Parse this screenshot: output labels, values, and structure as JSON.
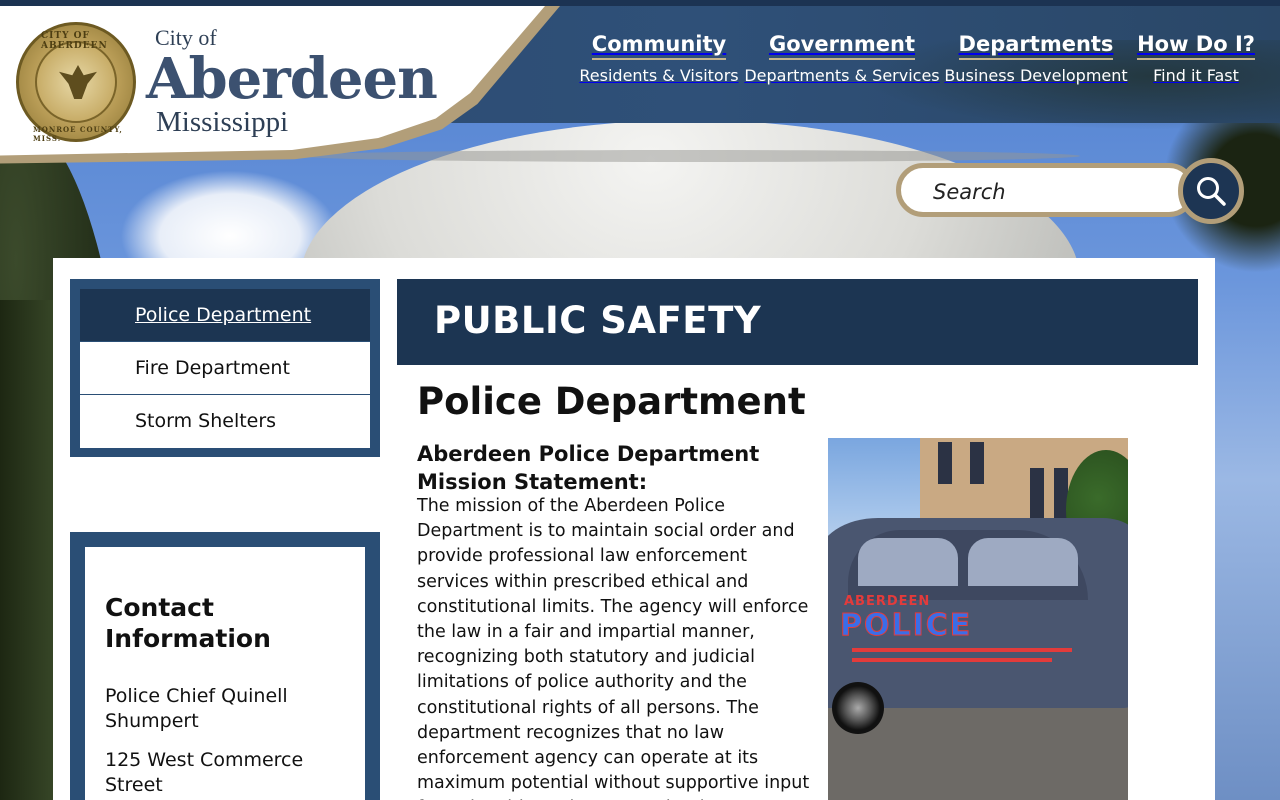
{
  "brand": {
    "city_of": "City of",
    "name": "Aberdeen",
    "state": "Mississippi",
    "seal_top": "CITY OF ABERDEEN",
    "seal_bottom": "MONROE COUNTY, MISS."
  },
  "nav": [
    {
      "title": "Community",
      "subtitle": "Residents & Visitors"
    },
    {
      "title": "Government",
      "subtitle": "Departments & Services"
    },
    {
      "title": "Departments",
      "subtitle": "Business Development"
    },
    {
      "title": "How Do I?",
      "subtitle": "Find it Fast"
    }
  ],
  "search": {
    "placeholder": "Search"
  },
  "sidebar": {
    "items": [
      {
        "label": "Police Department",
        "active": true
      },
      {
        "label": "Fire Department",
        "active": false
      },
      {
        "label": "Storm Shelters",
        "active": false
      }
    ]
  },
  "contact": {
    "title": "Contact Information",
    "lines": [
      "Police Chief Quinell Shumpert",
      "125 West Commerce Street"
    ]
  },
  "banner": {
    "title": "PUBLIC SAFETY"
  },
  "main": {
    "page_title": "Police Department",
    "mission_heading": "Aberdeen Police Department Mission Statement:",
    "mission_body": "The mission of the Aberdeen Police Department is to maintain social order and provide professional law enforcement services within prescribed ethical and constitutional limits. The agency will enforce the law in a fair and impartial manner, recognizing both statutory and judicial limitations of police authority and the constitutional rights of all persons. The department recognizes that no law enforcement agency can operate at its maximum potential without supportive input from the citizens it serves. The department"
  },
  "photo": {
    "car_text_1": "ABERDEEN",
    "car_text_2": "POLICE"
  },
  "colors": {
    "navy": "#1c3552",
    "header_blue": "#2b4a70",
    "gold": "#b29e79"
  }
}
